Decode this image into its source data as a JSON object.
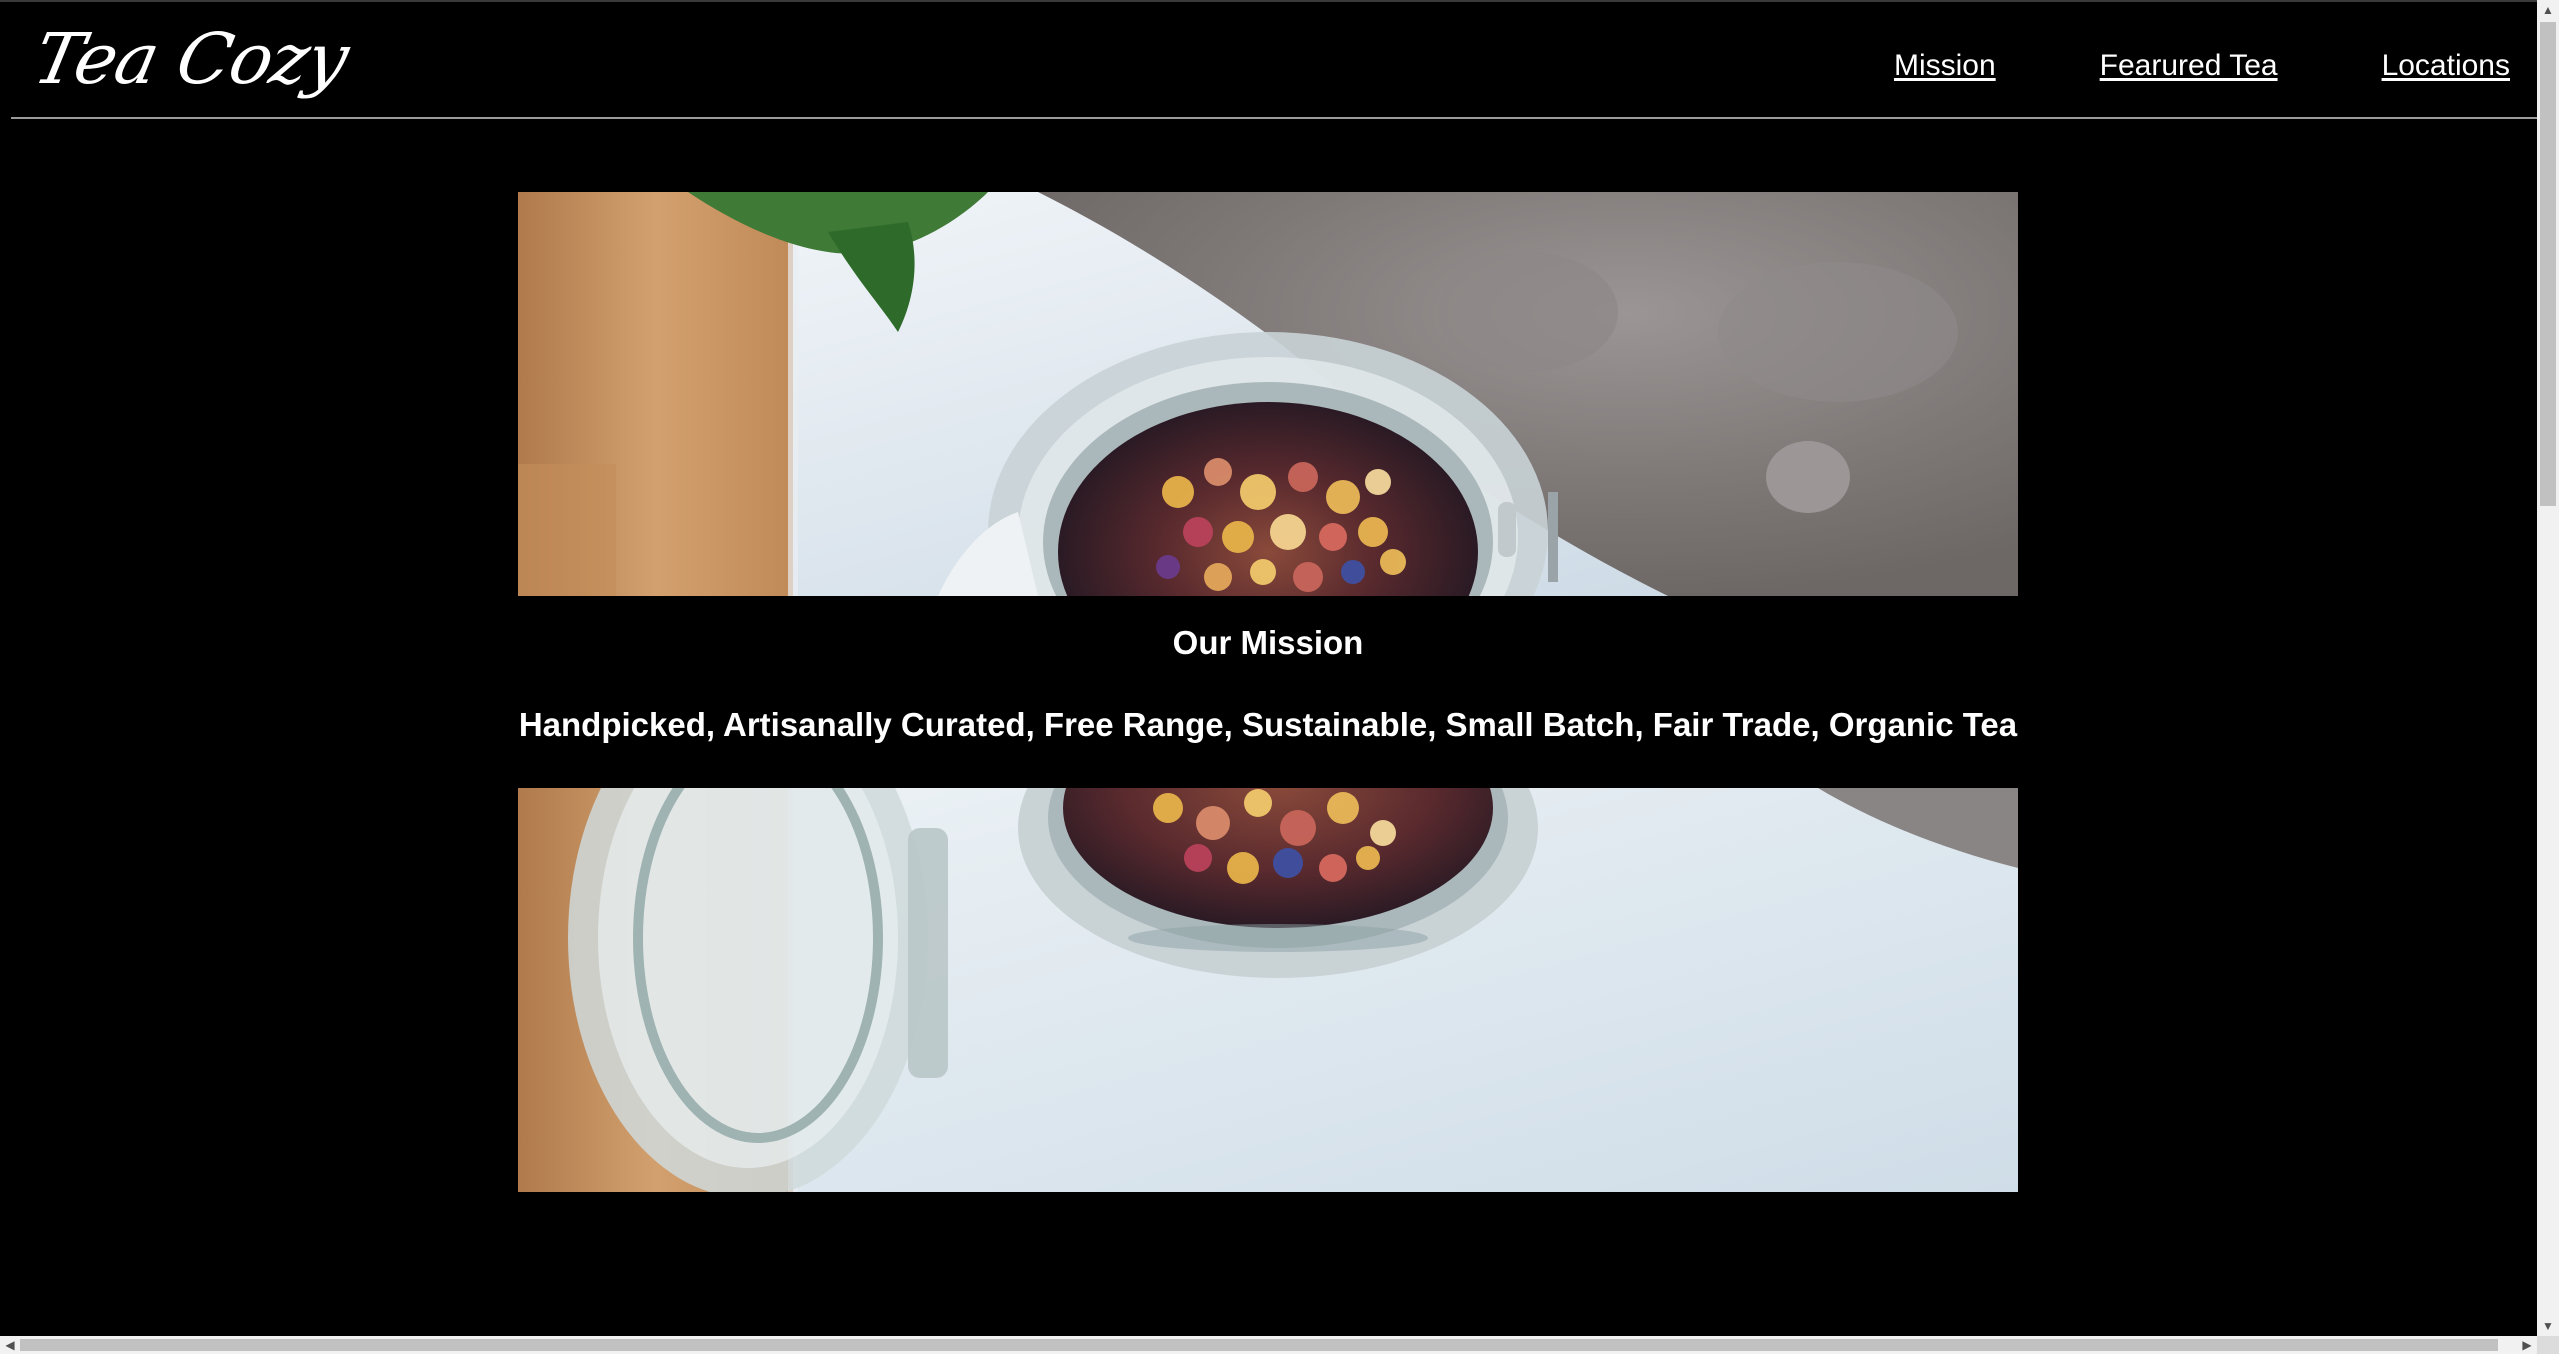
{
  "brand": {
    "logo_text": "Tea Cozy"
  },
  "nav": {
    "items": [
      {
        "label": "Mission"
      },
      {
        "label": "Fearured Tea"
      },
      {
        "label": "Locations"
      }
    ]
  },
  "main": {
    "mission_title": "Our Mission",
    "mission_tagline": "Handpicked, Artisanally Curated, Free Range, Sustainable, Small Batch, Fair Trade, Organic Tea"
  },
  "icons": {
    "scroll_up": "arrow-up-icon",
    "scroll_down": "arrow-down-icon",
    "scroll_left": "arrow-left-icon",
    "scroll_right": "arrow-right-icon"
  },
  "colors": {
    "background": "#000000",
    "text": "#ffffff",
    "divider": "#9a9a9a"
  }
}
